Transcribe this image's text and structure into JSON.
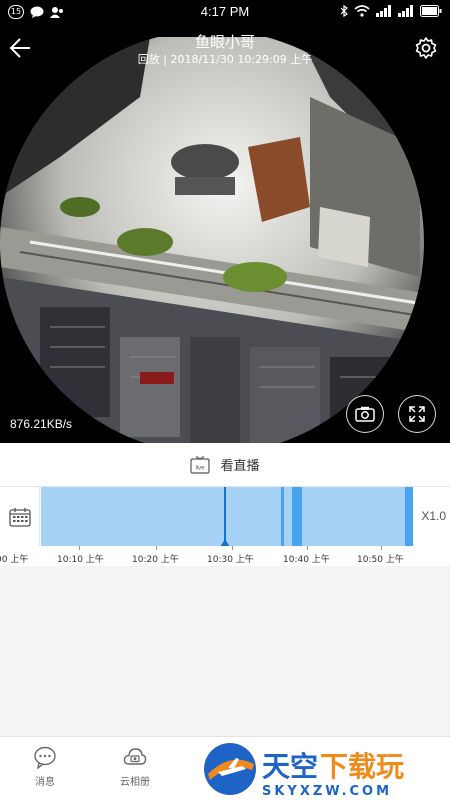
{
  "status": {
    "notification_count": "15",
    "time": "4:17 PM",
    "battery_icon": "battery-icon"
  },
  "camera": {
    "title": "鱼眼小哥",
    "subtitle": "回放 | 2018/11/30 10:29:09 上午",
    "bitrate": "876.21KB/s"
  },
  "live": {
    "label": "看直播"
  },
  "timeline": {
    "speed": "X1.0",
    "cursor_time": "10:29:09",
    "ticks": [
      "00 上午",
      "10:10 上午",
      "10:20 上午",
      "10:30 上午",
      "10:40 上午",
      "10:50 上午"
    ]
  },
  "nav": {
    "items": [
      {
        "label": "消息",
        "icon": "message-icon"
      },
      {
        "label": "云相册",
        "icon": "cloud-album-icon"
      }
    ]
  },
  "watermark": {
    "title": "天空下载玩",
    "url": "SKYXZW.COM"
  },
  "colors": {
    "timeline_fill": "#a6d2f6",
    "timeline_record": "#4aa3ee",
    "cursor": "#1b73c8",
    "watermark_blue": "#1e63c6",
    "watermark_orange": "#f08a1a"
  }
}
